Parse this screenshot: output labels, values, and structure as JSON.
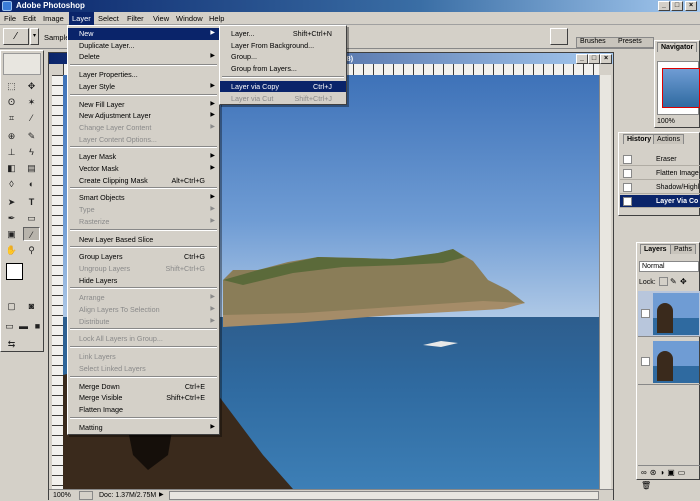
{
  "app": {
    "title": "Adobe Photoshop"
  },
  "menubar": [
    "File",
    "Edit",
    "Image",
    "Layer",
    "Select",
    "Filter",
    "View",
    "Window",
    "Help"
  ],
  "optionsbar": {
    "sample_label": "Sample",
    "tabs": [
      "Brushes",
      "Presets"
    ]
  },
  "document": {
    "title_suffix": "B/8)",
    "zoom": "100%",
    "doc_info": "Doc: 1.37M/2.75M"
  },
  "layer_menu": [
    {
      "label": "New",
      "shortcut": "",
      "submenu": true,
      "disabled": false,
      "highlight": true
    },
    {
      "label": "Duplicate Layer...",
      "shortcut": "",
      "submenu": false,
      "disabled": false
    },
    {
      "label": "Delete",
      "shortcut": "",
      "submenu": true,
      "disabled": false
    },
    {
      "sep": true
    },
    {
      "label": "Layer Properties...",
      "shortcut": "",
      "submenu": false,
      "disabled": false
    },
    {
      "label": "Layer Style",
      "shortcut": "",
      "submenu": true,
      "disabled": false
    },
    {
      "sep": true
    },
    {
      "label": "New Fill Layer",
      "shortcut": "",
      "submenu": true,
      "disabled": false
    },
    {
      "label": "New Adjustment Layer",
      "shortcut": "",
      "submenu": true,
      "disabled": false
    },
    {
      "label": "Change Layer Content",
      "shortcut": "",
      "submenu": true,
      "disabled": true
    },
    {
      "label": "Layer Content Options...",
      "shortcut": "",
      "submenu": false,
      "disabled": true
    },
    {
      "sep": true
    },
    {
      "label": "Layer Mask",
      "shortcut": "",
      "submenu": true,
      "disabled": false
    },
    {
      "label": "Vector Mask",
      "shortcut": "",
      "submenu": true,
      "disabled": false
    },
    {
      "label": "Create Clipping Mask",
      "shortcut": "Alt+Ctrl+G",
      "submenu": false,
      "disabled": false
    },
    {
      "sep": true
    },
    {
      "label": "Smart Objects",
      "shortcut": "",
      "submenu": true,
      "disabled": false
    },
    {
      "label": "Type",
      "shortcut": "",
      "submenu": true,
      "disabled": true
    },
    {
      "label": "Rasterize",
      "shortcut": "",
      "submenu": true,
      "disabled": true
    },
    {
      "sep": true
    },
    {
      "label": "New Layer Based Slice",
      "shortcut": "",
      "submenu": false,
      "disabled": false
    },
    {
      "sep": true
    },
    {
      "label": "Group Layers",
      "shortcut": "Ctrl+G",
      "submenu": false,
      "disabled": false
    },
    {
      "label": "Ungroup Layers",
      "shortcut": "Shift+Ctrl+G",
      "submenu": false,
      "disabled": true
    },
    {
      "label": "Hide Layers",
      "shortcut": "",
      "submenu": false,
      "disabled": false
    },
    {
      "sep": true
    },
    {
      "label": "Arrange",
      "shortcut": "",
      "submenu": true,
      "disabled": true
    },
    {
      "label": "Align Layers To Selection",
      "shortcut": "",
      "submenu": true,
      "disabled": true
    },
    {
      "label": "Distribute",
      "shortcut": "",
      "submenu": true,
      "disabled": true
    },
    {
      "sep": true
    },
    {
      "label": "Lock All Layers in Group...",
      "shortcut": "",
      "submenu": false,
      "disabled": true
    },
    {
      "sep": true
    },
    {
      "label": "Link Layers",
      "shortcut": "",
      "submenu": false,
      "disabled": true
    },
    {
      "label": "Select Linked Layers",
      "shortcut": "",
      "submenu": false,
      "disabled": true
    },
    {
      "sep": true
    },
    {
      "label": "Merge Down",
      "shortcut": "Ctrl+E",
      "submenu": false,
      "disabled": false
    },
    {
      "label": "Merge Visible",
      "shortcut": "Shift+Ctrl+E",
      "submenu": false,
      "disabled": false
    },
    {
      "label": "Flatten Image",
      "shortcut": "",
      "submenu": false,
      "disabled": false
    },
    {
      "sep": true
    },
    {
      "label": "Matting",
      "shortcut": "",
      "submenu": true,
      "disabled": false
    }
  ],
  "new_submenu": [
    {
      "label": "Layer...",
      "shortcut": "Shift+Ctrl+N",
      "disabled": false
    },
    {
      "label": "Layer From Background...",
      "shortcut": "",
      "disabled": false
    },
    {
      "label": "Group...",
      "shortcut": "",
      "disabled": false
    },
    {
      "label": "Group from Layers...",
      "shortcut": "",
      "disabled": false
    },
    {
      "sep": true
    },
    {
      "label": "Layer via Copy",
      "shortcut": "Ctrl+J",
      "disabled": false,
      "highlight": true
    },
    {
      "label": "Layer via Cut",
      "shortcut": "Shift+Ctrl+J",
      "disabled": true
    }
  ],
  "navigator": {
    "tab": "Navigator",
    "zoom": "100%"
  },
  "history": {
    "tabs": [
      "History",
      "Actions"
    ],
    "rows": [
      "Eraser",
      "Flatten Image",
      "Shadow/Highl",
      "Layer Via Co"
    ]
  },
  "layers": {
    "tabs": [
      "Layers",
      "Paths"
    ],
    "blend": "Normal",
    "lock_label": "Lock:"
  }
}
